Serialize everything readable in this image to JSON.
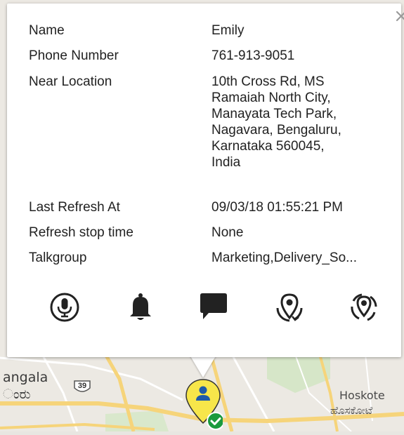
{
  "map": {
    "labels": {
      "bangalore_partial": "angala",
      "bangalore_local_partial": "ಂರು",
      "hoskote": "Hoskote",
      "hoskote_local": "ಹೊಸಕೋಟೆ"
    },
    "highway_shield": "39",
    "colors": {
      "road_major": "#f6d47a",
      "road_minor": "#ffffff",
      "land": "#ece9e3"
    }
  },
  "marker": {
    "pin_color": "#f7e64a",
    "status_color": "#1a9a3d",
    "icon": "person-icon"
  },
  "popup": {
    "close_label": "×",
    "fields": {
      "name": {
        "label": "Name",
        "value": "Emily"
      },
      "phone": {
        "label": "Phone Number",
        "value": "761-913-9051"
      },
      "near_location": {
        "label": "Near Location",
        "value": "10th Cross Rd, MS\nRamaiah North City,\nManayata Tech Park,\nNagavara, Bengaluru,\nKarnataka 560045,\nIndia"
      },
      "last_refresh": {
        "label": "Last Refresh At",
        "value": "09/03/18 01:55:21 PM"
      },
      "refresh_stop": {
        "label": "Refresh stop time",
        "value": "None"
      },
      "talkgroup": {
        "label": "Talkgroup",
        "value": "Marketing,Delivery_So..."
      }
    },
    "actions": [
      {
        "name": "push-to-talk",
        "icon": "microphone-icon"
      },
      {
        "name": "alert",
        "icon": "bell-icon"
      },
      {
        "name": "message",
        "icon": "chat-bubble-icon"
      },
      {
        "name": "track-location",
        "icon": "location-track-icon"
      },
      {
        "name": "refresh-location",
        "icon": "location-refresh-icon"
      }
    ]
  }
}
